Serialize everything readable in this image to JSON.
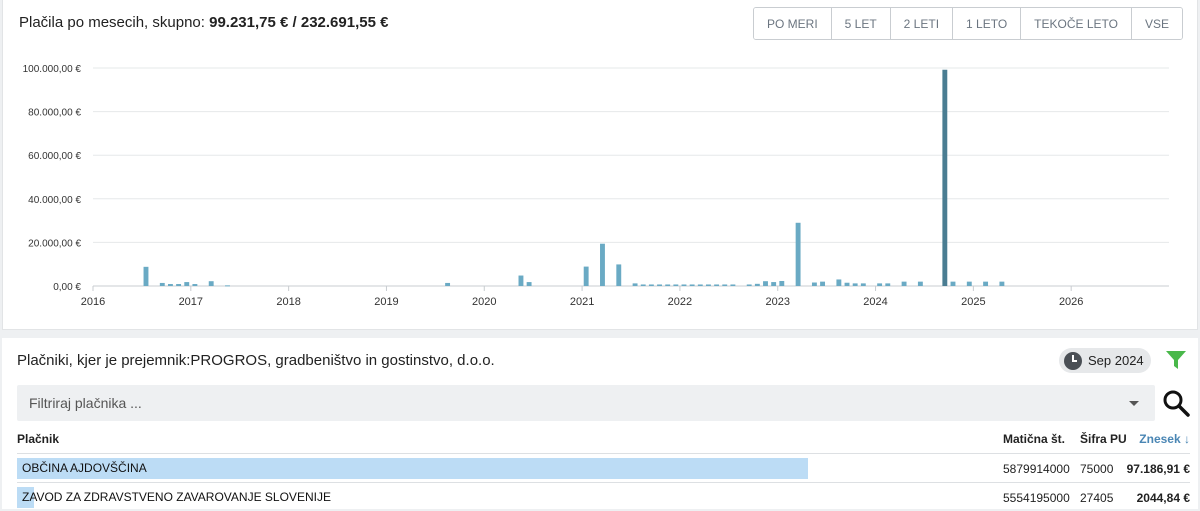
{
  "header": {
    "title_prefix": "Plačila po mesecih, skupno: ",
    "title_amount": "99.231,75 € / 232.691,55 €",
    "range_buttons": [
      "PO MERI",
      "5 LET",
      "2 LETI",
      "1 LETO",
      "TEKOČE LETO",
      "VSE"
    ]
  },
  "chart_data": {
    "type": "bar",
    "y_ticks": [
      "100.000,00 €",
      "80.000,00 €",
      "60.000,00 €",
      "40.000,00 €",
      "20.000,00 €",
      "0,00 €"
    ],
    "x_ticks": [
      "2016",
      "2017",
      "2018",
      "2019",
      "2020",
      "2021",
      "2022",
      "2023",
      "2024",
      "2025",
      "2026"
    ],
    "ylim": [
      0,
      100000
    ],
    "xlim": [
      "2016-01",
      "2026-12"
    ],
    "grid": true,
    "bar_color": "#6aaac4",
    "highlight_color": "#4a7d92",
    "highlight_month": "2024-09",
    "series": [
      {
        "points": [
          [
            "2016-07",
            8800
          ],
          [
            "2016-09",
            1400
          ],
          [
            "2016-10",
            900
          ],
          [
            "2016-11",
            900
          ],
          [
            "2016-12",
            1800
          ],
          [
            "2017-01",
            900
          ],
          [
            "2017-03",
            2200
          ],
          [
            "2017-05",
            300
          ],
          [
            "2019-08",
            1400
          ],
          [
            "2020-05",
            4800
          ],
          [
            "2020-06",
            1800
          ],
          [
            "2021-01",
            8900
          ],
          [
            "2021-03",
            19400
          ],
          [
            "2021-05",
            9900
          ],
          [
            "2021-07",
            1200
          ],
          [
            "2021-08",
            700
          ],
          [
            "2021-09",
            700
          ],
          [
            "2021-10",
            700
          ],
          [
            "2021-11",
            700
          ],
          [
            "2021-12",
            700
          ],
          [
            "2022-01",
            700
          ],
          [
            "2022-02",
            700
          ],
          [
            "2022-03",
            700
          ],
          [
            "2022-04",
            700
          ],
          [
            "2022-05",
            700
          ],
          [
            "2022-06",
            700
          ],
          [
            "2022-07",
            700
          ],
          [
            "2022-09",
            700
          ],
          [
            "2022-10",
            1000
          ],
          [
            "2022-11",
            2200
          ],
          [
            "2022-12",
            1800
          ],
          [
            "2023-01",
            2300
          ],
          [
            "2023-03",
            29000
          ],
          [
            "2023-05",
            1600
          ],
          [
            "2023-06",
            2000
          ],
          [
            "2023-08",
            3000
          ],
          [
            "2023-09",
            1500
          ],
          [
            "2023-10",
            1200
          ],
          [
            "2023-11",
            1200
          ],
          [
            "2024-01",
            1200
          ],
          [
            "2024-02",
            1200
          ],
          [
            "2024-04",
            2000
          ],
          [
            "2024-06",
            2000
          ],
          [
            "2024-09",
            99200
          ],
          [
            "2024-10",
            2000
          ],
          [
            "2024-12",
            2000
          ],
          [
            "2025-02",
            2000
          ],
          [
            "2025-04",
            2000
          ]
        ]
      }
    ]
  },
  "payers": {
    "title": "Plačniki, kjer je prejemnik:PROGROS, gradbeništvo in gostinstvo, d.o.o.",
    "date": "Sep 2024",
    "filter_placeholder": "Filtriraj plačnika ...",
    "columns": {
      "payer": "Plačnik",
      "reg": "Matična št.",
      "code": "Šifra PU",
      "amount": "Znesek ↓"
    },
    "rows": [
      {
        "name": "OBČINA AJDOVŠČINA",
        "reg": "5879914000",
        "code": "75000",
        "amount": "97.186,91 €",
        "share": 0.9794
      },
      {
        "name": "ZAVOD ZA ZDRAVSTVENO ZAVAROVANJE SLOVENIJE",
        "reg": "5554195000",
        "code": "27405",
        "amount": "2044,84 €",
        "share": 0.0206
      }
    ]
  }
}
